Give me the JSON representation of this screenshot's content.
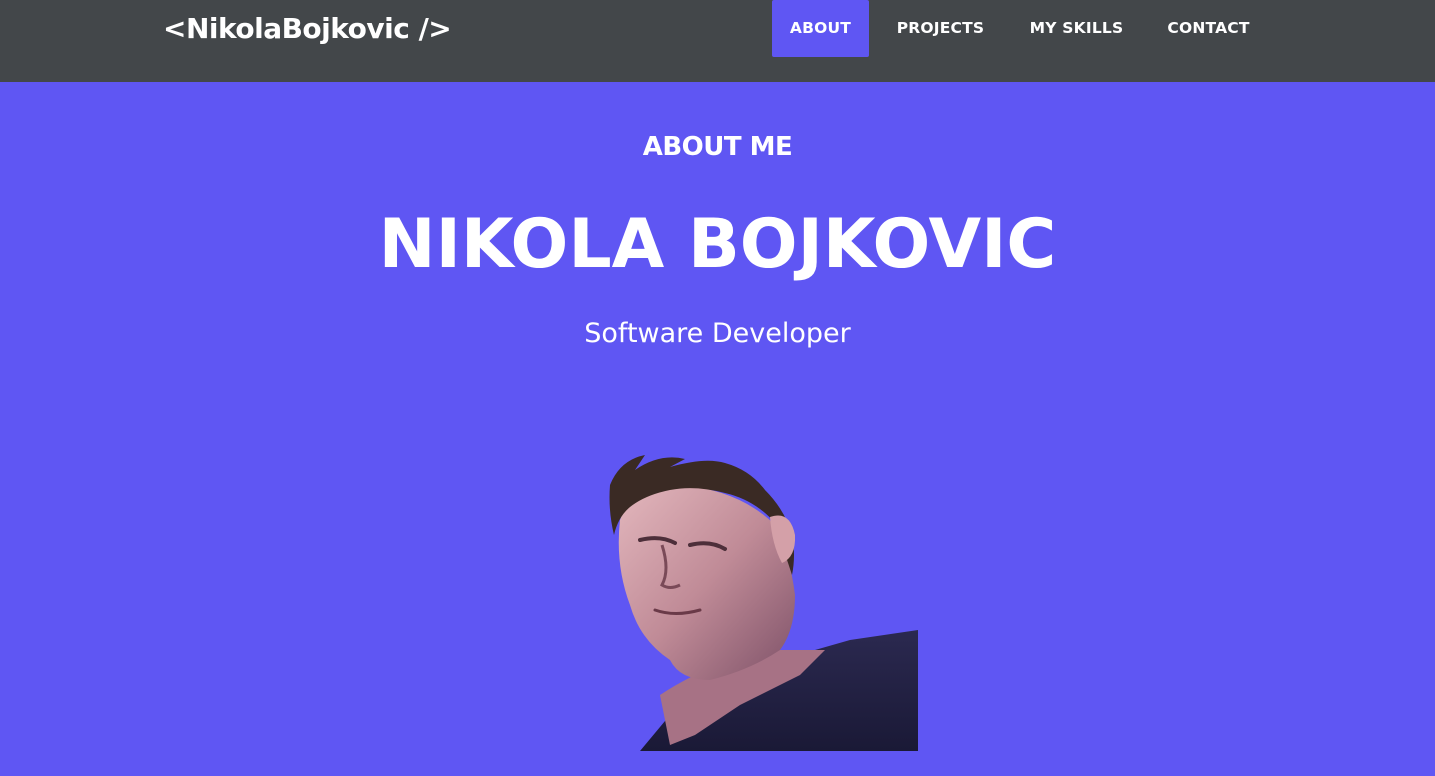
{
  "navbar": {
    "brand": "<NikolaBojkovic />",
    "items": [
      {
        "label": "ABOUT",
        "active": true
      },
      {
        "label": "PROJECTS",
        "active": false
      },
      {
        "label": "MY SKILLS",
        "active": false
      },
      {
        "label": "CONTACT",
        "active": false
      }
    ]
  },
  "about": {
    "section_label": "ABOUT ME",
    "name": "NIKOLA BOJKOVIC",
    "role": "Software Developer"
  },
  "colors": {
    "accent": "#5f56f3",
    "navbar_bg": "#43474a",
    "text": "#ffffff"
  }
}
